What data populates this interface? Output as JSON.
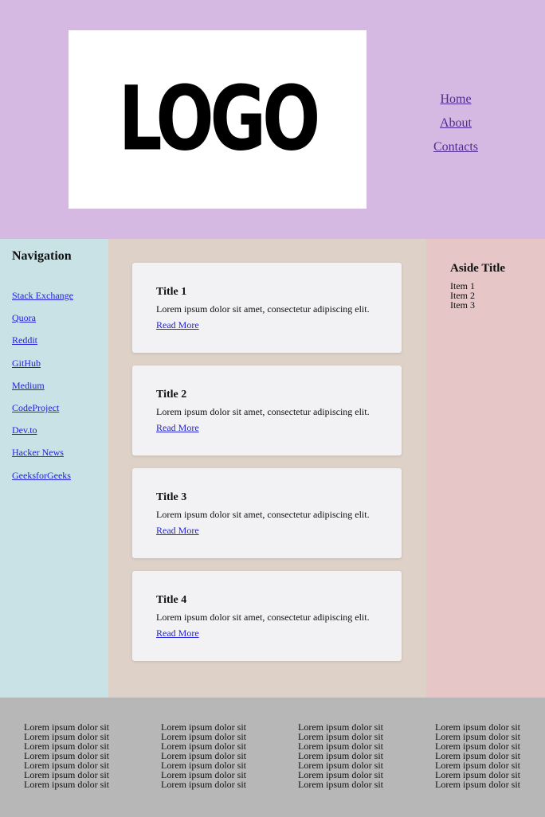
{
  "header": {
    "logo_text": "LOGO",
    "nav": [
      "Home",
      "About",
      "Contacts"
    ]
  },
  "sidebar": {
    "title": "Navigation",
    "links": [
      "Stack Exchange",
      "Quora",
      "Reddit",
      "GitHub",
      "Medium",
      "CodeProject",
      "Dev.to",
      "Hacker News",
      "GeeksforGeeks"
    ]
  },
  "main": {
    "cards": [
      {
        "title": "Title 1",
        "text": "Lorem ipsum dolor sit amet, consectetur adipiscing elit.",
        "link": "Read More"
      },
      {
        "title": "Title 2",
        "text": "Lorem ipsum dolor sit amet, consectetur adipiscing elit.",
        "link": "Read More"
      },
      {
        "title": "Title 3",
        "text": "Lorem ipsum dolor sit amet, consectetur adipiscing elit.",
        "link": "Read More"
      },
      {
        "title": "Title 4",
        "text": "Lorem ipsum dolor sit amet, consectetur adipiscing elit.",
        "link": "Read More"
      }
    ]
  },
  "aside": {
    "title": "Aside Title",
    "items": [
      "Item 1",
      "Item 2",
      "Item 3"
    ]
  },
  "footer": {
    "columns": [
      [
        "Lorem ipsum dolor sit",
        "Lorem ipsum dolor sit",
        "Lorem ipsum dolor sit",
        "Lorem ipsum dolor sit",
        "Lorem ipsum dolor sit",
        "Lorem ipsum dolor sit",
        "Lorem ipsum dolor sit"
      ],
      [
        "Lorem ipsum dolor sit",
        "Lorem ipsum dolor sit",
        "Lorem ipsum dolor sit",
        "Lorem ipsum dolor sit",
        "Lorem ipsum dolor sit",
        "Lorem ipsum dolor sit",
        "Lorem ipsum dolor sit"
      ],
      [
        "Lorem ipsum dolor sit",
        "Lorem ipsum dolor sit",
        "Lorem ipsum dolor sit",
        "Lorem ipsum dolor sit",
        "Lorem ipsum dolor sit",
        "Lorem ipsum dolor sit",
        "Lorem ipsum dolor sit"
      ],
      [
        "Lorem ipsum dolor sit",
        "Lorem ipsum dolor sit",
        "Lorem ipsum dolor sit",
        "Lorem ipsum dolor sit",
        "Lorem ipsum dolor sit",
        "Lorem ipsum dolor sit",
        "Lorem ipsum dolor sit"
      ]
    ]
  },
  "colors": {
    "header_bg": "#d6b9e3",
    "sidebar_bg": "#c8e2e5",
    "main_bg": "#ded1c8",
    "aside_bg": "#e6c6c6",
    "footer_bg": "#b7b7b7",
    "card_bg": "#f2f2f4",
    "link": "#2222dd",
    "nav_link": "#4f2b8e"
  }
}
